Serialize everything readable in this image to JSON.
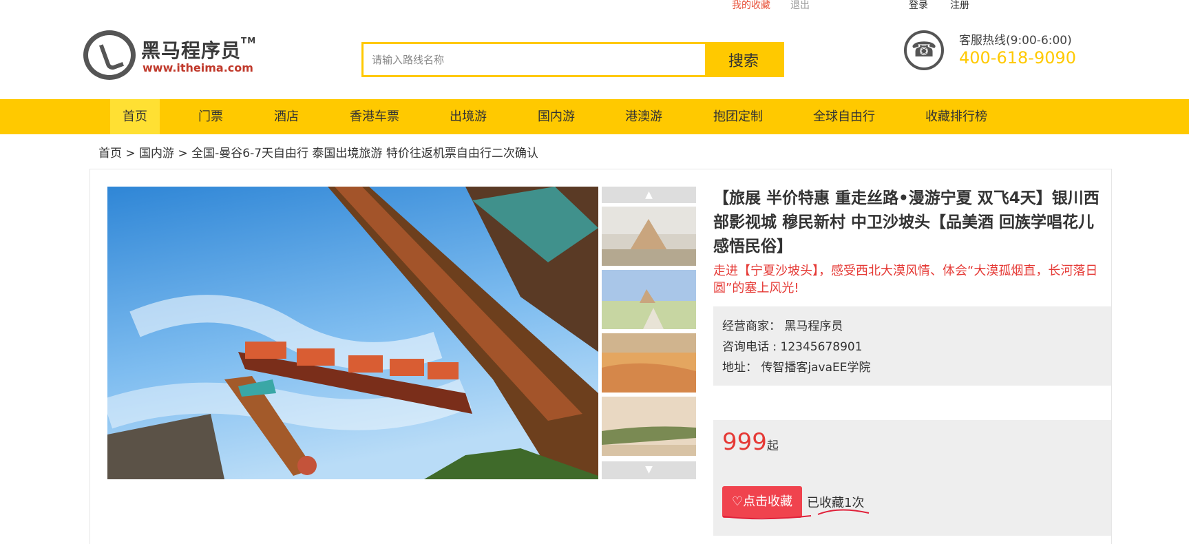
{
  "top_links": {
    "my_favorites": "我的收藏",
    "logout": "退出",
    "login": "登录",
    "register": "注册"
  },
  "logo": {
    "name": "黑马程序员",
    "tm": "TM",
    "url": "www.itheima.com"
  },
  "search": {
    "placeholder": "请输入路线名称",
    "button": "搜索"
  },
  "hotline": {
    "label": "客服热线(9:00-6:00)",
    "number": "400-618-9090"
  },
  "nav": {
    "items": [
      {
        "label": "首页",
        "active": true
      },
      {
        "label": "门票"
      },
      {
        "label": "酒店"
      },
      {
        "label": "香港车票"
      },
      {
        "label": "出境游"
      },
      {
        "label": "国内游"
      },
      {
        "label": "港澳游"
      },
      {
        "label": "抱团定制"
      },
      {
        "label": "全球自由行"
      },
      {
        "label": "收藏排行榜"
      }
    ]
  },
  "breadcrumb": {
    "home": "首页",
    "sep": " > ",
    "category": "国内游",
    "current": "全国-曼谷6-7天自由行 泰国出境旅游 特价往返机票自由行二次确认"
  },
  "product": {
    "title": "【旅展 半价特惠 重走丝路•漫游宁夏 双飞4天】银川西部影视城 穆民新村 中卫沙坡头【品美酒 回族学唱花儿 感悟民俗】",
    "subtitle": "走进【宁夏沙坡头】，感受西北大漠风情、体会“大漠孤烟直，长河落日圆”的塞上风光!",
    "merchant_label": "经营商家：",
    "merchant": "黑马程序员",
    "phone_label": "咨询电话 :",
    "phone": "12345678901",
    "address_label": "地址：",
    "address": "传智播客javaEE学院",
    "price": "999",
    "price_suffix": "起",
    "fav_button": "点击收藏",
    "fav_count": "已收藏1次"
  },
  "colors": {
    "brand_yellow": "#ffc900",
    "accent_red": "#e53935",
    "button_red": "#f0434e"
  },
  "icons": {
    "logo": "horse-logo-icon",
    "hotline": "phone-icon",
    "favorite": "heart-icon",
    "thumb_up": "arrow-up-icon",
    "thumb_down": "arrow-down-icon"
  }
}
